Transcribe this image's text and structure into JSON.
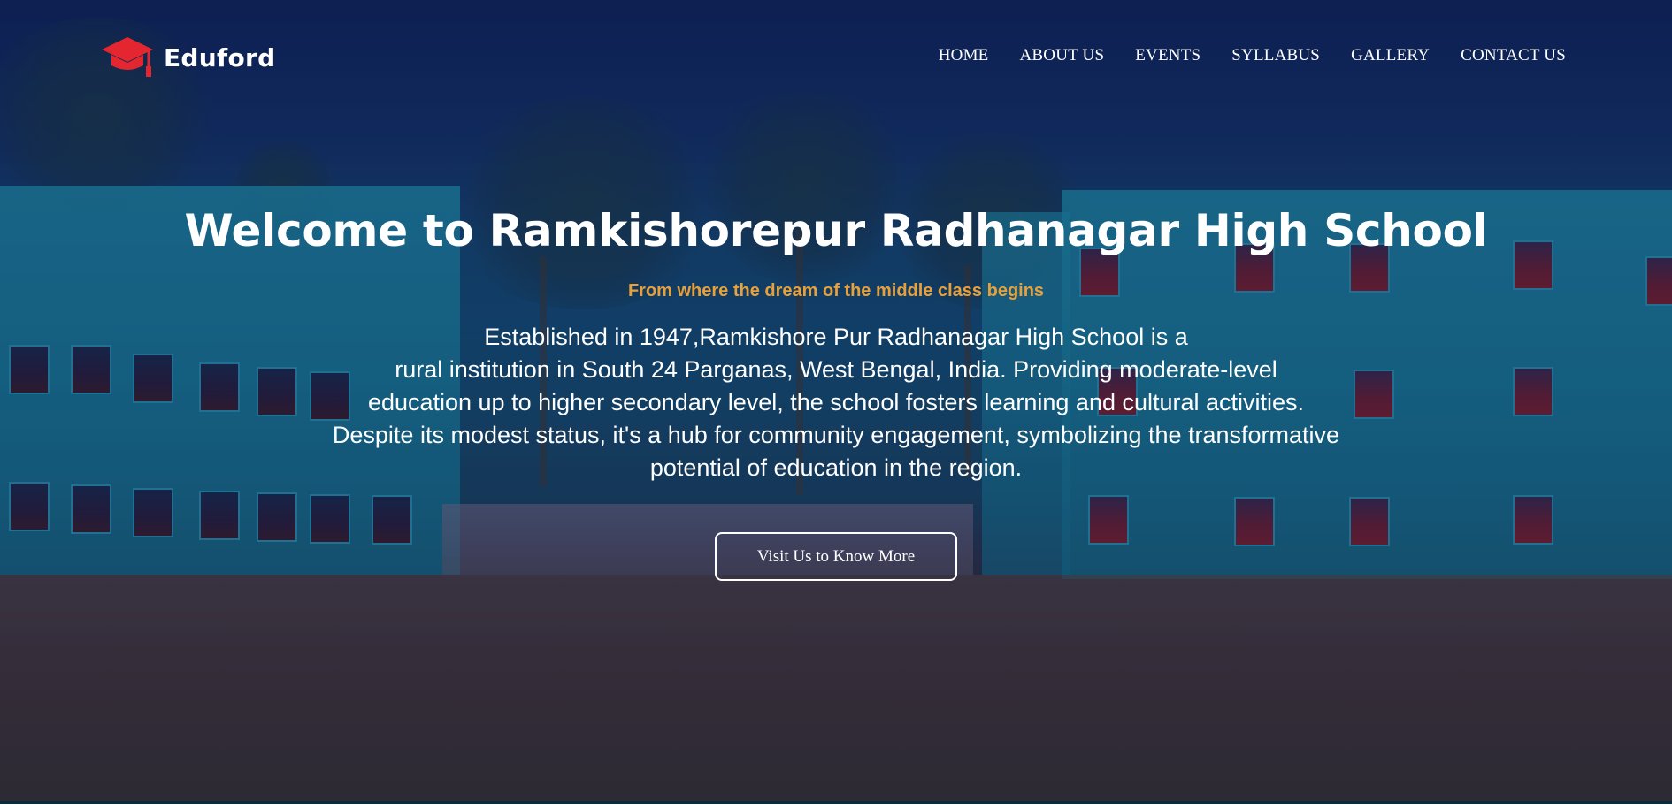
{
  "brand": {
    "name": "Eduford",
    "icon": "graduation-cap-icon",
    "icon_color": "#e3262f"
  },
  "nav": {
    "items": [
      {
        "label": "HOME"
      },
      {
        "label": "ABOUT US"
      },
      {
        "label": "EVENTS"
      },
      {
        "label": "SYLLABUS"
      },
      {
        "label": "GALLERY"
      },
      {
        "label": "CONTACT US"
      }
    ]
  },
  "hero": {
    "title": "Welcome to Ramkishorepur Radhanagar High School",
    "tagline": "From where the dream of the middle class begins",
    "description_lines": [
      "Established in 1947,Ramkishore Pur Radhanagar High School is a",
      "rural institution in South 24 Parganas, West Bengal, India. Providing moderate-level",
      "education up to higher secondary level, the school fosters learning and cultural activities.",
      "Despite its modest status, it's a hub for community engagement, symbolizing the transformative",
      "potential of education in the region."
    ],
    "cta_label": "Visit Us to Know More"
  },
  "colors": {
    "accent": "#e8a13a",
    "text": "#ffffff",
    "logo_red": "#e3262f"
  }
}
